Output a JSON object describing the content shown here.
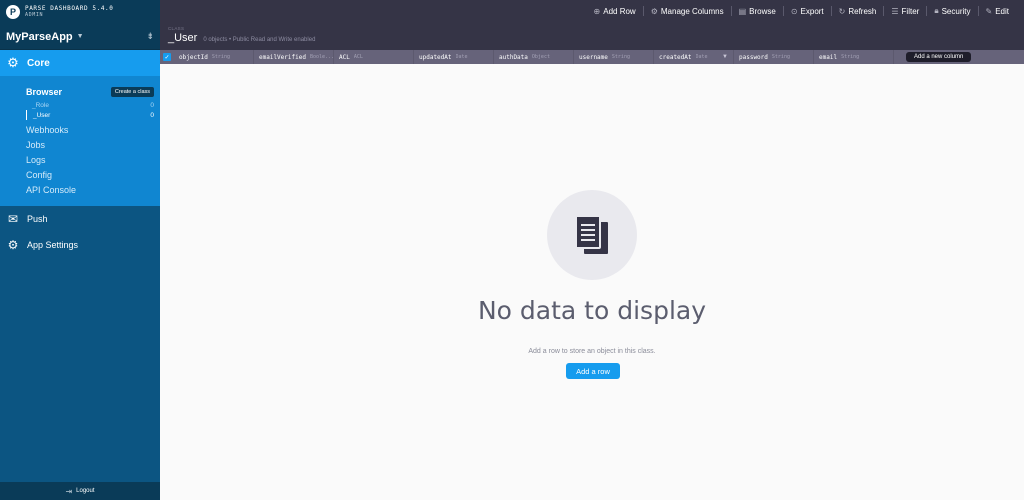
{
  "brand": {
    "line1": "PARSE DASHBOARD 5.4.0",
    "line2": "ADMIN",
    "logo_letter": "P"
  },
  "app_selector": {
    "name": "MyParseApp"
  },
  "sidebar": {
    "core_label": "Core",
    "browser_label": "Browser",
    "create_class_label": "Create a class",
    "classes": [
      {
        "name": "_Role",
        "count": "0"
      },
      {
        "name": "_User",
        "count": "0"
      }
    ],
    "sub_items": [
      "Webhooks",
      "Jobs",
      "Logs",
      "Config",
      "API Console"
    ],
    "push_label": "Push",
    "app_settings_label": "App Settings",
    "logout_label": "Logout"
  },
  "toolbar": {
    "add_row": "Add Row",
    "manage_columns": "Manage Columns",
    "browse": "Browse",
    "export": "Export",
    "refresh": "Refresh",
    "filter": "Filter",
    "security": "Security",
    "edit": "Edit"
  },
  "header": {
    "crumb": "CLASS",
    "class_name": "_User",
    "subtitle": "0 objects • Public Read and Write enabled"
  },
  "columns": [
    {
      "name": "objectId",
      "type": "String"
    },
    {
      "name": "emailVerified",
      "type": "Boole..."
    },
    {
      "name": "ACL",
      "type": "ACL"
    },
    {
      "name": "updatedAt",
      "type": "Date"
    },
    {
      "name": "authData",
      "type": "Object"
    },
    {
      "name": "username",
      "type": "String"
    },
    {
      "name": "createdAt",
      "type": "Date"
    },
    {
      "name": "password",
      "type": "String"
    },
    {
      "name": "email",
      "type": "String"
    }
  ],
  "add_column_label": "Add a new column",
  "empty_state": {
    "title": "No data to display",
    "description": "Add a row to store an object in this class.",
    "button": "Add a row"
  },
  "colors": {
    "sidebar": "#0c5582",
    "accent": "#169cee",
    "header": "#353446",
    "columns_bar": "#66637a"
  }
}
